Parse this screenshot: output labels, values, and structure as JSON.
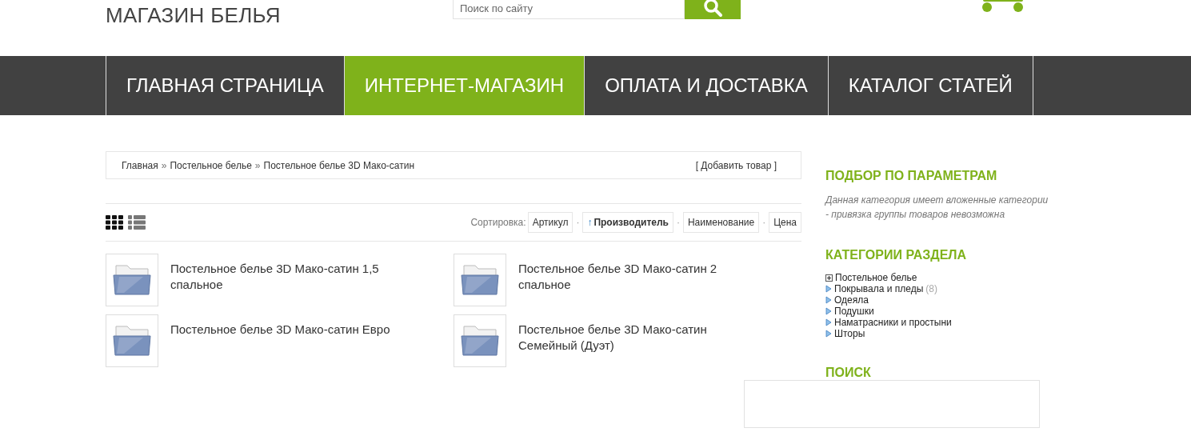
{
  "header": {
    "logo": "МАГАЗИН БЕЛЬЯ",
    "search": {
      "placeholder": "Поиск по сайту"
    }
  },
  "nav": [
    {
      "label": "ГЛАВНАЯ СТРАНИЦА",
      "selected": false
    },
    {
      "label": "ИНТЕРНЕТ-МАГАЗИН",
      "selected": true
    },
    {
      "label": "ОПЛАТА И ДОСТАВКА",
      "selected": false
    },
    {
      "label": "КАТАЛОГ СТАТЕЙ",
      "selected": false
    }
  ],
  "breadcrumbs": [
    "Главная",
    "Постельное белье",
    "Постельное белье 3D Мако-сатин"
  ],
  "breadcrumb_separator": "»",
  "add_product": "[ Добавить товар ]",
  "views": [
    {
      "kind": "grid",
      "selected": true
    },
    {
      "kind": "list",
      "selected": false
    }
  ],
  "sort": {
    "label": "Сортировка:",
    "separator": "·",
    "direction_arrow": "↑",
    "options": [
      {
        "label": "Артикул",
        "selected": false
      },
      {
        "label": "Производитель",
        "selected": true
      },
      {
        "label": "Наименование",
        "selected": false
      },
      {
        "label": "Цена",
        "selected": false
      }
    ]
  },
  "categories": [
    "Постельное белье 3D Мако-сатин 1,5 спальное",
    "Постельное белье 3D Мако-сатин 2 спальное",
    "Постельное белье 3D Мако-сатин Евро",
    "Постельное белье 3D Мако-сатин Семейный (Дуэт)"
  ],
  "sidebar": {
    "filter_title": "ПОДБОР ПО ПАРАМЕТРАМ",
    "filter_note": "Данная категория имеет вложенные категории - привязка группы товаров невозможна",
    "sections_title": "КАТЕГОРИИ РАЗДЕЛА",
    "sections": [
      {
        "label": "Постельное белье",
        "kind": "expandable"
      },
      {
        "label": "Покрывала и пледы",
        "kind": "leaf",
        "count": "(8)"
      },
      {
        "label": "Одеяла",
        "kind": "leaf"
      },
      {
        "label": "Подушки",
        "kind": "leaf"
      },
      {
        "label": "Наматрасники и простыни",
        "kind": "leaf"
      },
      {
        "label": "Шторы",
        "kind": "leaf"
      }
    ],
    "search_title": "ПОИСК"
  }
}
